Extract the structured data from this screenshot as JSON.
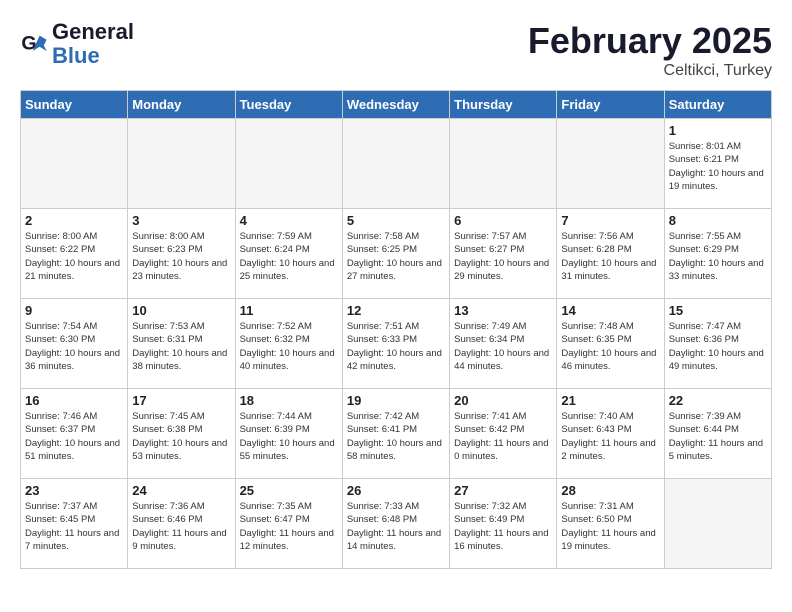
{
  "header": {
    "logo_line1": "General",
    "logo_line2": "Blue",
    "month_title": "February 2025",
    "location": "Celtikci, Turkey"
  },
  "weekdays": [
    "Sunday",
    "Monday",
    "Tuesday",
    "Wednesday",
    "Thursday",
    "Friday",
    "Saturday"
  ],
  "weeks": [
    [
      {
        "day": "",
        "info": ""
      },
      {
        "day": "",
        "info": ""
      },
      {
        "day": "",
        "info": ""
      },
      {
        "day": "",
        "info": ""
      },
      {
        "day": "",
        "info": ""
      },
      {
        "day": "",
        "info": ""
      },
      {
        "day": "1",
        "info": "Sunrise: 8:01 AM\nSunset: 6:21 PM\nDaylight: 10 hours and 19 minutes."
      }
    ],
    [
      {
        "day": "2",
        "info": "Sunrise: 8:00 AM\nSunset: 6:22 PM\nDaylight: 10 hours and 21 minutes."
      },
      {
        "day": "3",
        "info": "Sunrise: 8:00 AM\nSunset: 6:23 PM\nDaylight: 10 hours and 23 minutes."
      },
      {
        "day": "4",
        "info": "Sunrise: 7:59 AM\nSunset: 6:24 PM\nDaylight: 10 hours and 25 minutes."
      },
      {
        "day": "5",
        "info": "Sunrise: 7:58 AM\nSunset: 6:25 PM\nDaylight: 10 hours and 27 minutes."
      },
      {
        "day": "6",
        "info": "Sunrise: 7:57 AM\nSunset: 6:27 PM\nDaylight: 10 hours and 29 minutes."
      },
      {
        "day": "7",
        "info": "Sunrise: 7:56 AM\nSunset: 6:28 PM\nDaylight: 10 hours and 31 minutes."
      },
      {
        "day": "8",
        "info": "Sunrise: 7:55 AM\nSunset: 6:29 PM\nDaylight: 10 hours and 33 minutes."
      }
    ],
    [
      {
        "day": "9",
        "info": "Sunrise: 7:54 AM\nSunset: 6:30 PM\nDaylight: 10 hours and 36 minutes."
      },
      {
        "day": "10",
        "info": "Sunrise: 7:53 AM\nSunset: 6:31 PM\nDaylight: 10 hours and 38 minutes."
      },
      {
        "day": "11",
        "info": "Sunrise: 7:52 AM\nSunset: 6:32 PM\nDaylight: 10 hours and 40 minutes."
      },
      {
        "day": "12",
        "info": "Sunrise: 7:51 AM\nSunset: 6:33 PM\nDaylight: 10 hours and 42 minutes."
      },
      {
        "day": "13",
        "info": "Sunrise: 7:49 AM\nSunset: 6:34 PM\nDaylight: 10 hours and 44 minutes."
      },
      {
        "day": "14",
        "info": "Sunrise: 7:48 AM\nSunset: 6:35 PM\nDaylight: 10 hours and 46 minutes."
      },
      {
        "day": "15",
        "info": "Sunrise: 7:47 AM\nSunset: 6:36 PM\nDaylight: 10 hours and 49 minutes."
      }
    ],
    [
      {
        "day": "16",
        "info": "Sunrise: 7:46 AM\nSunset: 6:37 PM\nDaylight: 10 hours and 51 minutes."
      },
      {
        "day": "17",
        "info": "Sunrise: 7:45 AM\nSunset: 6:38 PM\nDaylight: 10 hours and 53 minutes."
      },
      {
        "day": "18",
        "info": "Sunrise: 7:44 AM\nSunset: 6:39 PM\nDaylight: 10 hours and 55 minutes."
      },
      {
        "day": "19",
        "info": "Sunrise: 7:42 AM\nSunset: 6:41 PM\nDaylight: 10 hours and 58 minutes."
      },
      {
        "day": "20",
        "info": "Sunrise: 7:41 AM\nSunset: 6:42 PM\nDaylight: 11 hours and 0 minutes."
      },
      {
        "day": "21",
        "info": "Sunrise: 7:40 AM\nSunset: 6:43 PM\nDaylight: 11 hours and 2 minutes."
      },
      {
        "day": "22",
        "info": "Sunrise: 7:39 AM\nSunset: 6:44 PM\nDaylight: 11 hours and 5 minutes."
      }
    ],
    [
      {
        "day": "23",
        "info": "Sunrise: 7:37 AM\nSunset: 6:45 PM\nDaylight: 11 hours and 7 minutes."
      },
      {
        "day": "24",
        "info": "Sunrise: 7:36 AM\nSunset: 6:46 PM\nDaylight: 11 hours and 9 minutes."
      },
      {
        "day": "25",
        "info": "Sunrise: 7:35 AM\nSunset: 6:47 PM\nDaylight: 11 hours and 12 minutes."
      },
      {
        "day": "26",
        "info": "Sunrise: 7:33 AM\nSunset: 6:48 PM\nDaylight: 11 hours and 14 minutes."
      },
      {
        "day": "27",
        "info": "Sunrise: 7:32 AM\nSunset: 6:49 PM\nDaylight: 11 hours and 16 minutes."
      },
      {
        "day": "28",
        "info": "Sunrise: 7:31 AM\nSunset: 6:50 PM\nDaylight: 11 hours and 19 minutes."
      },
      {
        "day": "",
        "info": ""
      }
    ]
  ]
}
